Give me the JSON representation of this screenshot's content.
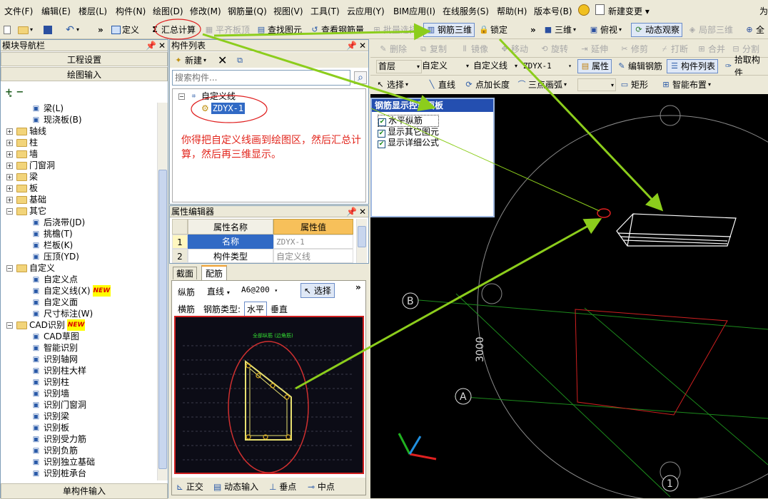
{
  "menu": [
    "文件(F)",
    "编辑(E)",
    "楼层(L)",
    "构件(N)",
    "绘图(D)",
    "修改(M)",
    "钢筋量(Q)",
    "视图(V)",
    "工具(T)",
    "云应用(Y)",
    "BIM应用(I)",
    "在线服务(S)",
    "帮助(H)",
    "版本号(B)",
    "新建变更 ▾"
  ],
  "menu_right": "为",
  "toolbar1": {
    "define": "定义",
    "sum_calc": "汇总计算",
    "flat_slab": "平齐板顶",
    "find_elem": "查找图元",
    "view_rebar": "查看钢筋量",
    "batch_select": "批量选择",
    "rebar_3d": "钢筋三维",
    "lock": "锁定",
    "three_d": "三维",
    "top_view": "俯视",
    "dynamic_view": "动态观察",
    "local_3d": "局部三维",
    "full": "全"
  },
  "toolbar2": [
    "删除",
    "复制",
    "镜像",
    "移动",
    "旋转",
    "延伸",
    "修剪",
    "打断",
    "合并",
    "分割"
  ],
  "toolbar3": {
    "floor": "首层",
    "custom": "自定义",
    "custom_line": "自定义线",
    "element": "ZDYX-1",
    "attr": "属性",
    "edit_rebar": "编辑钢筋",
    "elem_list": "构件列表",
    "pick": "拾取构件"
  },
  "toolbar4": {
    "select": "选择",
    "line": "直线",
    "point_len": "点加长度",
    "arc": "三点画弧",
    "rect": "矩形",
    "smart": "智能布置"
  },
  "nav": {
    "title": "模块导航栏",
    "btn1": "工程设置",
    "btn2": "绘图输入",
    "bottom": "单构件输入",
    "tree": [
      {
        "label": "梁(L)",
        "type": "item",
        "indent": 2
      },
      {
        "label": "现浇板(B)",
        "type": "item",
        "indent": 2
      },
      {
        "label": "轴线",
        "type": "folder",
        "indent": 0
      },
      {
        "label": "柱",
        "type": "folder",
        "indent": 0
      },
      {
        "label": "墙",
        "type": "folder",
        "indent": 0
      },
      {
        "label": "门窗洞",
        "type": "folder",
        "indent": 0
      },
      {
        "label": "梁",
        "type": "folder",
        "indent": 0
      },
      {
        "label": "板",
        "type": "folder",
        "indent": 0
      },
      {
        "label": "基础",
        "type": "folder",
        "indent": 0
      },
      {
        "label": "其它",
        "type": "folder-open",
        "indent": 0
      },
      {
        "label": "后浇带(JD)",
        "type": "item",
        "indent": 2
      },
      {
        "label": "挑檐(T)",
        "type": "item",
        "indent": 2
      },
      {
        "label": "栏板(K)",
        "type": "item",
        "indent": 2
      },
      {
        "label": "压顶(YD)",
        "type": "item",
        "indent": 2
      },
      {
        "label": "自定义",
        "type": "folder-open",
        "indent": 0
      },
      {
        "label": "自定义点",
        "type": "item",
        "indent": 2
      },
      {
        "label": "自定义线(X)",
        "type": "item-new",
        "indent": 2
      },
      {
        "label": "自定义面",
        "type": "item",
        "indent": 2
      },
      {
        "label": "尺寸标注(W)",
        "type": "item",
        "indent": 2
      },
      {
        "label": "CAD识别",
        "type": "folder-new",
        "indent": 0
      },
      {
        "label": "CAD草图",
        "type": "item",
        "indent": 2
      },
      {
        "label": "智能识别",
        "type": "item",
        "indent": 2
      },
      {
        "label": "识别轴网",
        "type": "item",
        "indent": 2
      },
      {
        "label": "识别柱大样",
        "type": "item",
        "indent": 2
      },
      {
        "label": "识别柱",
        "type": "item",
        "indent": 2
      },
      {
        "label": "识别墙",
        "type": "item",
        "indent": 2
      },
      {
        "label": "识别门窗洞",
        "type": "item",
        "indent": 2
      },
      {
        "label": "识别梁",
        "type": "item",
        "indent": 2
      },
      {
        "label": "识别板",
        "type": "item",
        "indent": 2
      },
      {
        "label": "识别受力筋",
        "type": "item",
        "indent": 2
      },
      {
        "label": "识别负筋",
        "type": "item",
        "indent": 2
      },
      {
        "label": "识别独立基础",
        "type": "item",
        "indent": 2
      },
      {
        "label": "识别桩承台",
        "type": "item",
        "indent": 2
      }
    ]
  },
  "comp_list": {
    "title": "构件列表",
    "new_btn": "新建",
    "search_placeholder": "搜索构件...",
    "root": "自定义线",
    "child": "ZDYX-1",
    "note": "你得把自定义线画到绘图区，然后汇总计算，然后再三维显示。"
  },
  "prop_editor": {
    "title": "属性编辑器",
    "col1": "属性名称",
    "col2": "属性值",
    "rows": [
      {
        "n": "1",
        "name": "名称",
        "value": "ZDYX-1"
      },
      {
        "n": "2",
        "name": "构件类型",
        "value": "自定义线"
      }
    ]
  },
  "rebar_tabs": {
    "tab1": "截面",
    "tab2": "配筋",
    "long_label": "纵筋",
    "line_mode": "直线",
    "spec": "A6@200",
    "select": "选择",
    "hor_label": "横筋",
    "rebar_type": "钢筋类型:",
    "horizontal": "水平",
    "vertical": "垂直",
    "preview_title": "全部纵筋 (边角筋)"
  },
  "bottom_bar": [
    "正交",
    "动态输入",
    "垂点",
    "中点"
  ],
  "ctrl_panel": {
    "title": "钢筋显示控制面板",
    "items": [
      "水平纵筋",
      "显示其它图元",
      "显示详细公式"
    ]
  },
  "canvas": {
    "axis_b": "B",
    "axis_a": "A",
    "axis_1": "1",
    "dim": "3000"
  },
  "colors": {
    "annotation": "#e2251c",
    "arrow": "#8ccd1c",
    "grid": "#1c8a1c",
    "panel_header": "#244fb0"
  }
}
